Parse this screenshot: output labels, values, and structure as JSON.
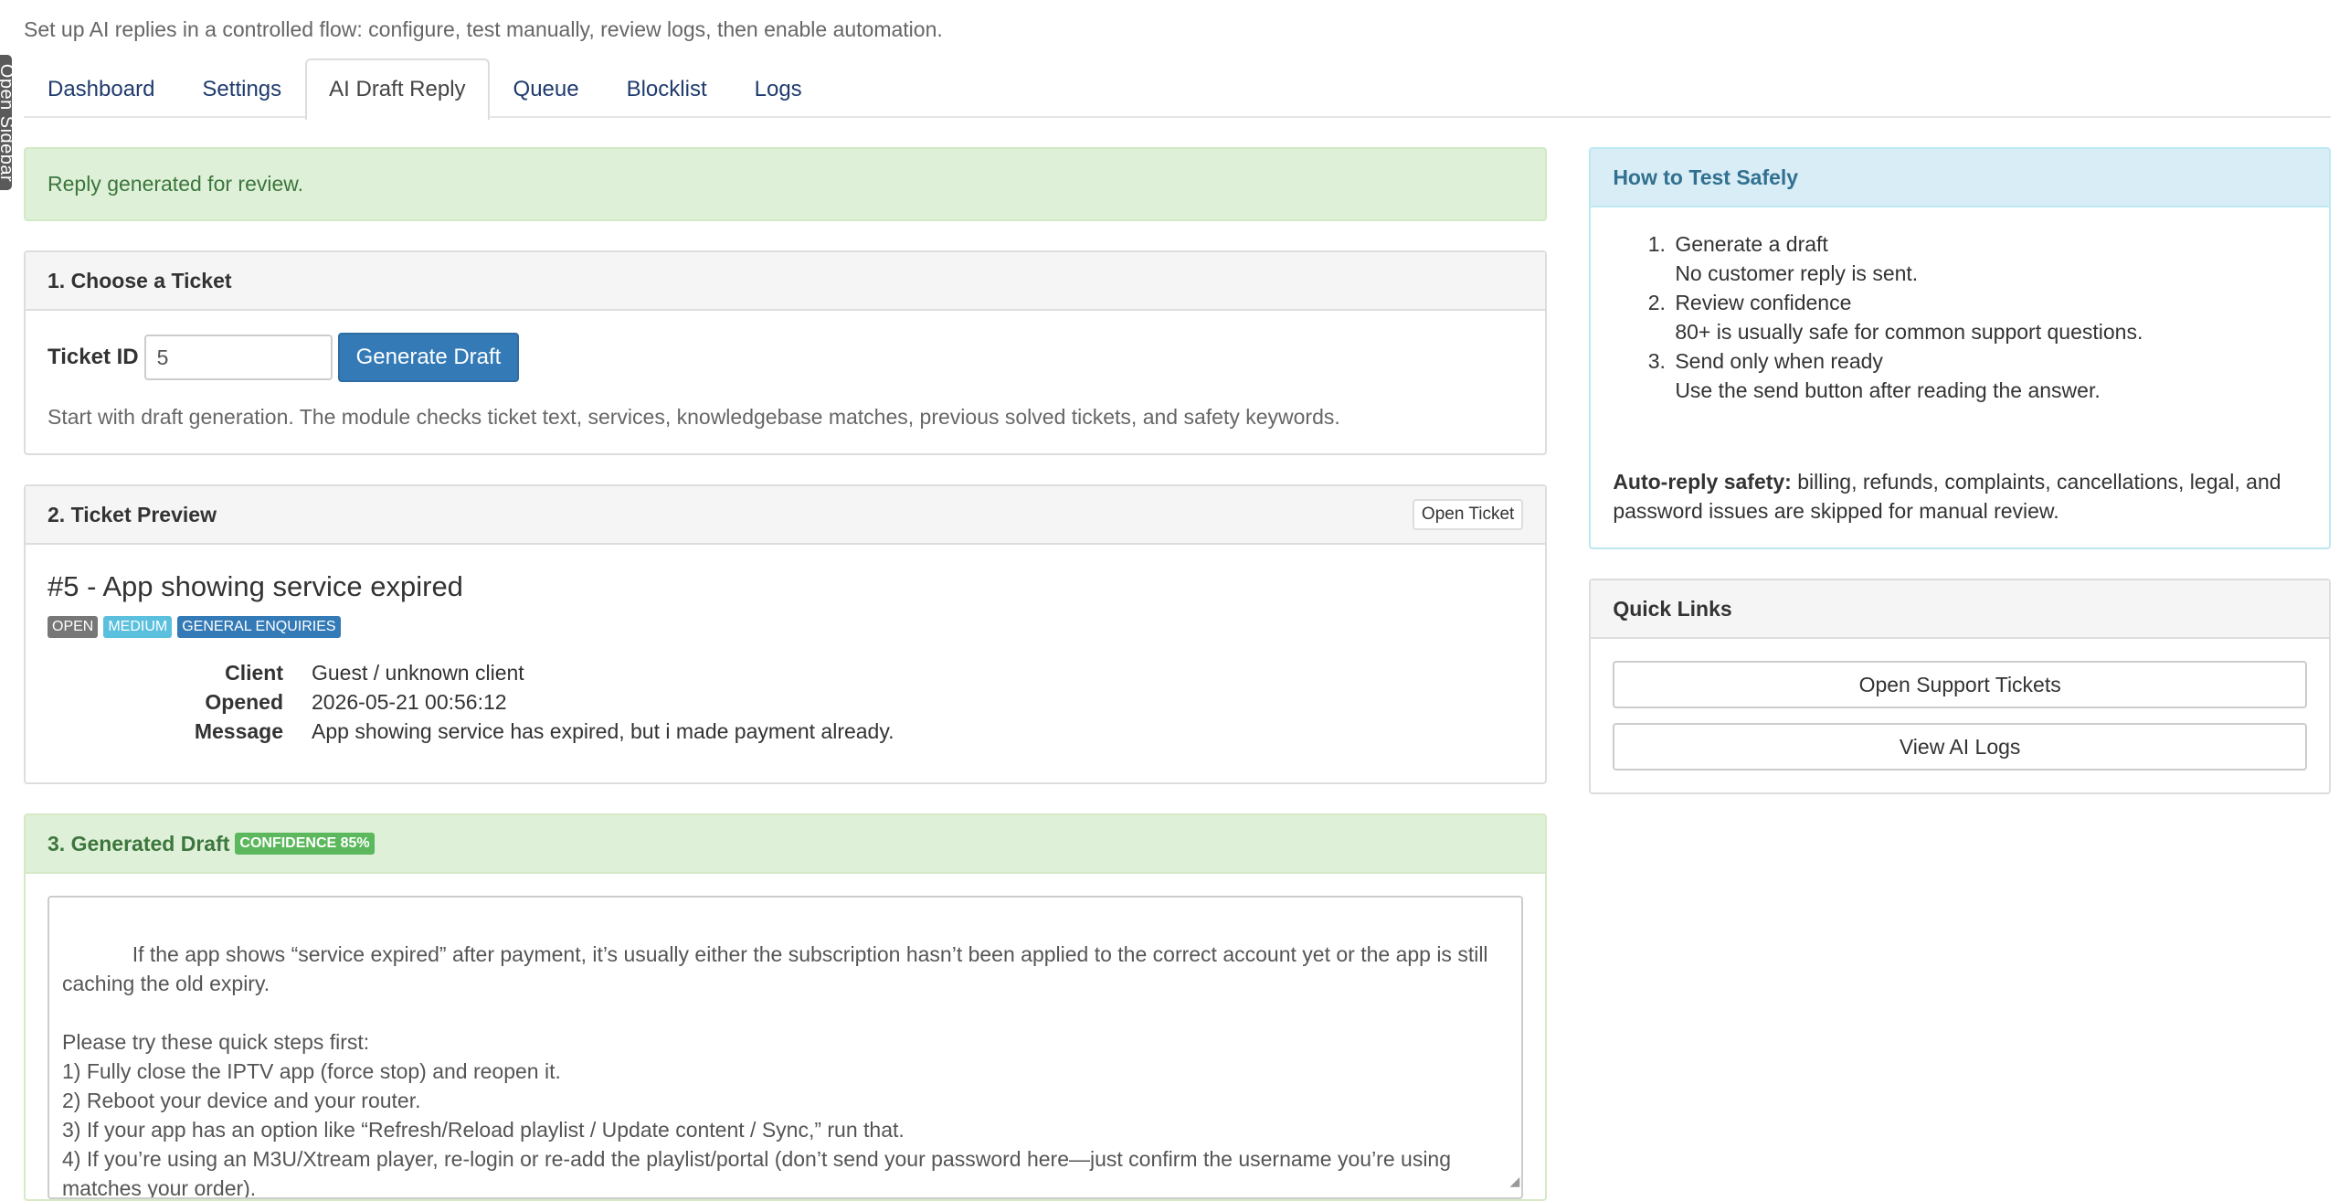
{
  "page": {
    "subtitle": "Set up AI replies in a controlled flow: configure, test manually, review logs, then enable automation.",
    "sidebar_toggle": "Open Sidebar"
  },
  "tabs": [
    {
      "label": "Dashboard"
    },
    {
      "label": "Settings"
    },
    {
      "label": "AI Draft Reply",
      "active": true
    },
    {
      "label": "Queue"
    },
    {
      "label": "Blocklist"
    },
    {
      "label": "Logs"
    }
  ],
  "alert": {
    "message": "Reply generated for review.",
    "color": "#dff0d8"
  },
  "choose": {
    "heading": "1. Choose a Ticket",
    "ticket_label": "Ticket ID",
    "ticket_value": "5",
    "generate_label": "Generate Draft",
    "help": "Start with draft generation. The module checks ticket text, services, knowledgebase matches, previous solved tickets, and safety keywords."
  },
  "preview": {
    "heading": "2. Ticket Preview",
    "open_ticket": "Open Ticket",
    "title": "#5 - App showing service expired",
    "badges": {
      "status": "OPEN",
      "priority": "MEDIUM",
      "department": "GENERAL ENQUIRIES"
    },
    "fields": {
      "client_label": "Client",
      "client_value": "Guest / unknown client",
      "opened_label": "Opened",
      "opened_value": "2026-05-21 00:56:12",
      "message_label": "Message",
      "message_value": "App showing service has expired, but i made payment already."
    }
  },
  "draft": {
    "heading": "3. Generated Draft",
    "confidence_badge": "CONFIDENCE 85%",
    "body": "If the app shows “service expired” after payment, it’s usually either the subscription hasn’t been applied to the correct account yet or the app is still caching the old expiry.\n\nPlease try these quick steps first:\n1) Fully close the IPTV app (force stop) and reopen it.\n2) Reboot your device and your router.\n3) If your app has an option like “Refresh/Reload playlist / Update content / Sync,” run that.\n4) If you’re using an M3U/Xtream player, re-login or re-add the playlist/portal (don’t send your password here—just confirm the username you’re using matches your order)."
  },
  "howto": {
    "heading": "How to Test Safely",
    "steps": [
      {
        "title": "Generate a draft",
        "note": "No customer reply is sent."
      },
      {
        "title": "Review confidence",
        "note": "80+ is usually safe for common support questions."
      },
      {
        "title": "Send only when ready",
        "note": "Use the send button after reading the answer."
      }
    ],
    "safety_label": "Auto-reply safety:",
    "safety_text": " billing, refunds, complaints, cancellations, legal, and password issues are skipped for manual review."
  },
  "quick_links": {
    "heading": "Quick Links",
    "open_support": "Open Support Tickets",
    "view_logs": "View AI Logs"
  },
  "colors": {
    "primary": "#337ab7",
    "success_bg": "#dff0d8",
    "success_text": "#3c763d",
    "info_bg": "#d9edf7",
    "info_text": "#31708f"
  }
}
